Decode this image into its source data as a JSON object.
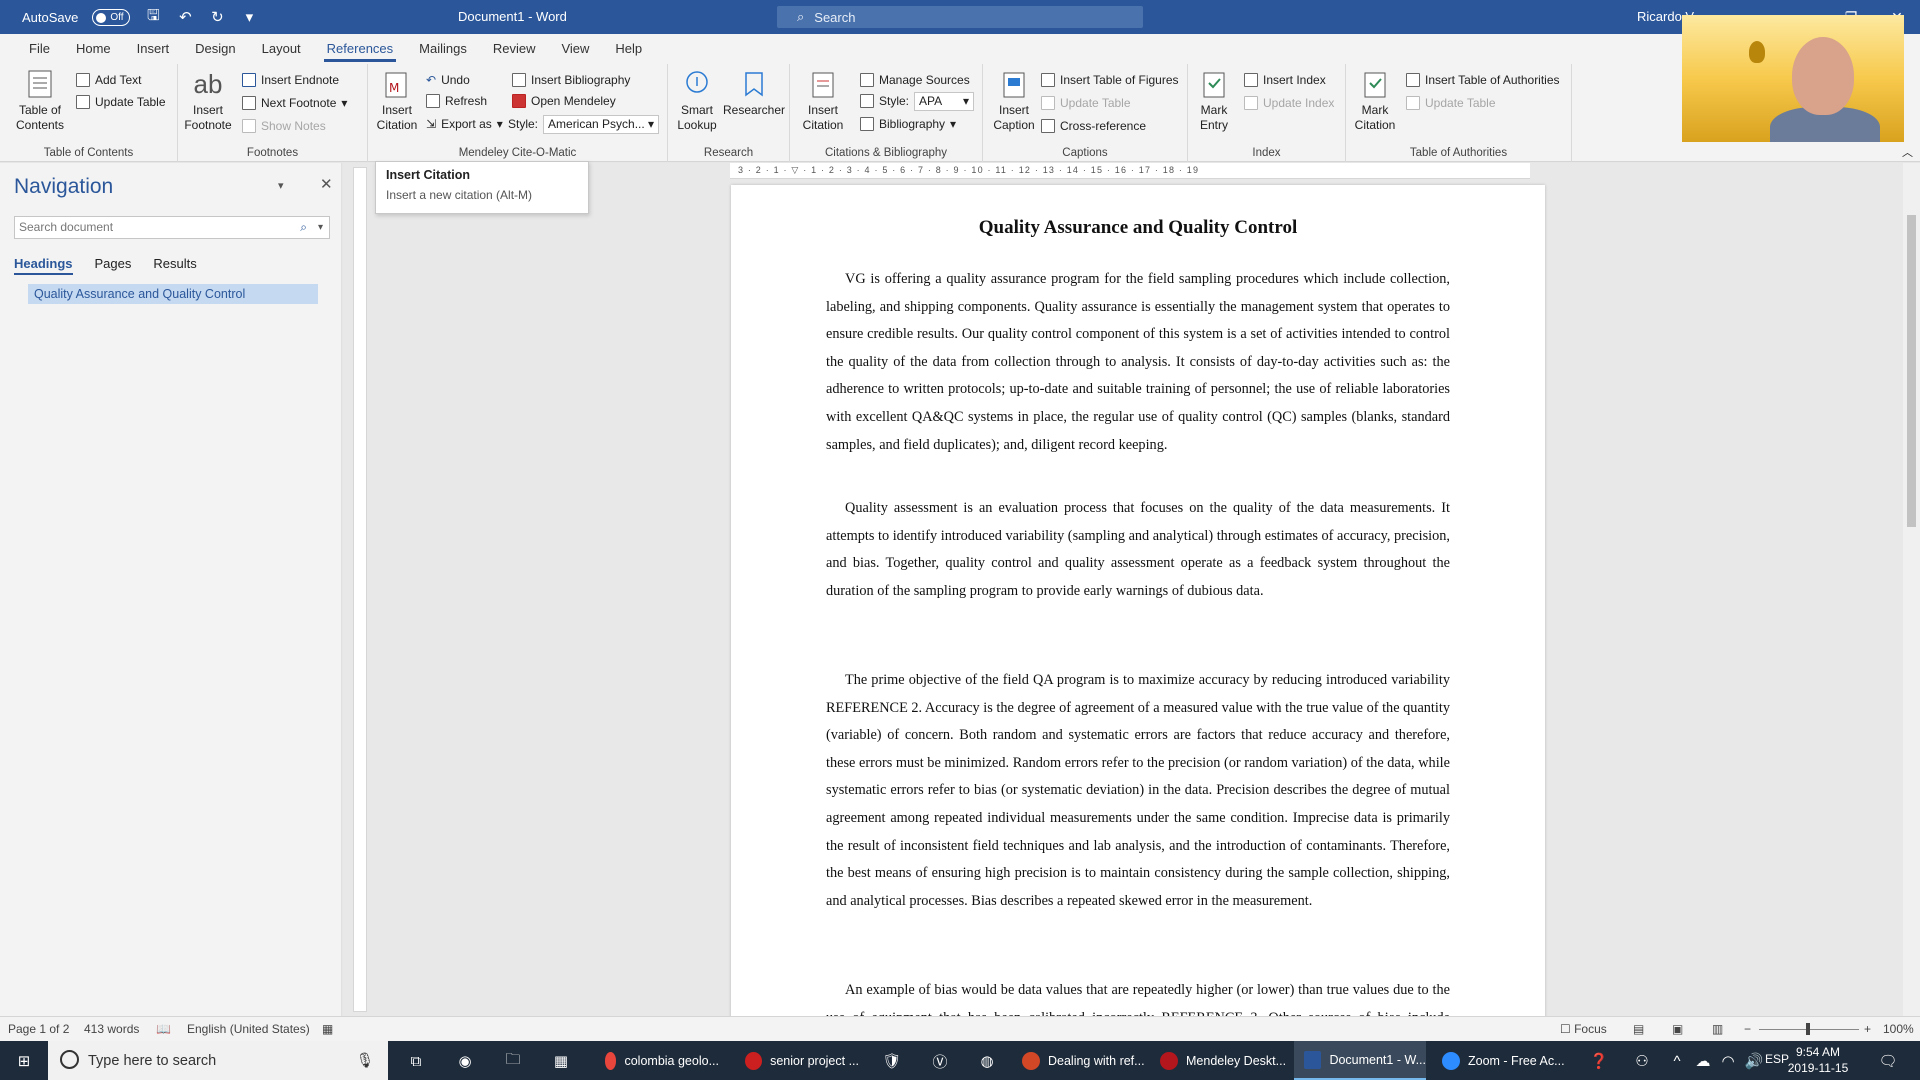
{
  "window": {
    "autosave_label": "AutoSave",
    "autosave_state": "Off",
    "title": "Document1 - Word",
    "search_label": "Search",
    "user_name": "Ricardo V"
  },
  "tabs": [
    "File",
    "Home",
    "Insert",
    "Design",
    "Layout",
    "References",
    "Mailings",
    "Review",
    "View",
    "Help"
  ],
  "active_tab": "References",
  "ribbon": {
    "toc": {
      "big": "Table of Contents",
      "add_text": "Add Text",
      "update_table": "Update Table",
      "label": "Table of Contents"
    },
    "footnotes": {
      "big": "Insert Footnote",
      "insert_endnote": "Insert Endnote",
      "next_footnote": "Next Footnote",
      "show_notes": "Show Notes",
      "label": "Footnotes"
    },
    "mendeley": {
      "big": "Insert Citation",
      "undo": "Undo",
      "refresh": "Refresh",
      "export_as": "Export as",
      "insert_bibliography": "Insert Bibliography",
      "open_mendeley": "Open Mendeley",
      "style_label": "Style:",
      "style_value": "American Psych...",
      "label": "Mendeley Cite-O-Matic"
    },
    "research": {
      "smart_lookup": "Smart Lookup",
      "researcher": "Researcher",
      "label": "Research"
    },
    "citations": {
      "big": "Insert Citation",
      "manage_sources": "Manage Sources",
      "style_label": "Style:",
      "style_value": "APA",
      "bibliography": "Bibliography",
      "label": "Citations & Bibliography"
    },
    "captions": {
      "big": "Insert Caption",
      "insert_tof": "Insert Table of Figures",
      "update_table": "Update Table",
      "cross_reference": "Cross-reference",
      "label": "Captions"
    },
    "index": {
      "big": "Mark Entry",
      "insert_index": "Insert Index",
      "update_index": "Update Index",
      "label": "Index"
    },
    "toa": {
      "big": "Mark Citation",
      "insert_toa": "Insert Table of Authorities",
      "update_table": "Update Table",
      "label": "Table of Authorities"
    }
  },
  "tooltip": {
    "title": "Insert Citation",
    "description": "Insert a new citation (Alt-M)"
  },
  "navigation": {
    "title": "Navigation",
    "search_placeholder": "Search document",
    "tabs": [
      "Headings",
      "Pages",
      "Results"
    ],
    "headings": [
      "Quality Assurance and Quality Control"
    ]
  },
  "ruler_numbers": "3 · 2 · 1 · ▽ · 1 · 2 · 3 · 4 · 5 · 6 · 7 · 8 · 9 · 10 · 11 · 12 · 13 · 14 · 15 · 16 · 17 · 18 · 19",
  "document": {
    "title": "Quality Assurance and Quality Control",
    "paragraphs": [
      "VG is offering a quality assurance program for the field sampling procedures which include collection, labeling, and shipping components. Quality assurance is essentially the management system that operates to ensure credible results. Our quality control component of this system is a set of activities intended to control the quality of the data from collection through to analysis. It consists of day-to-day activities such as: the adherence to written protocols; up-to-date and suitable training of personnel; the use of reliable laboratories with excellent QA&QC systems in place, the regular use of quality control (QC) samples (blanks, standard samples, and field duplicates); and, diligent record keeping.",
      "Quality assessment is an evaluation process that focuses on the quality of the data measurements. It attempts to identify introduced variability (sampling and analytical) through estimates of accuracy, precision, and bias. Together, quality control and quality assessment operate as a feedback system throughout the duration of the sampling program to provide early warnings of dubious data.",
      "The prime objective of the field QA program is to maximize accuracy by reducing introduced variability REFERENCE 2. Accuracy is the degree of agreement of a measured value with the true value of the quantity (variable) of concern. Both random and systematic errors are factors that reduce accuracy and therefore, these errors must be minimized. Random errors refer to the precision (or random variation) of the data, while systematic errors refer to bias (or systematic deviation) in the data. Precision describes the degree of mutual agreement among repeated individual measurements under the same condition. Imprecise data is primarily the result of inconsistent field techniques and lab analysis, and the introduction of contaminants. Therefore, the best means of ensuring high precision is to maintain consistency during the sample collection, shipping, and analytical processes. Bias describes a repeated skewed error in the measurement.",
      "An example of bias would be data values that are repeatedly higher (or lower) than true values due to the use of equipment that has been calibrated incorrectly REFERENCE 3. Other sources of bias include unrepresentative sampling, interference (such as temperature effect), and"
    ]
  },
  "statusbar": {
    "page": "Page 1 of 2",
    "words": "413 words",
    "language": "English (United States)",
    "focus": "Focus",
    "zoom": "100%"
  },
  "taskbar": {
    "search_placeholder": "Type here to search",
    "apps": [
      {
        "label": "colombia geolo...",
        "color": "#e8453c"
      },
      {
        "label": "senior project ...",
        "color": "#cc1f1f"
      },
      {
        "label": "Dealing with ref...",
        "color": "#d24726"
      },
      {
        "label": "Mendeley Deskt...",
        "color": "#b3161d"
      },
      {
        "label": "Document1 - W...",
        "color": "#2b579a"
      },
      {
        "label": "Zoom - Free Ac...",
        "color": "#2d8cff"
      }
    ],
    "language": "ESP",
    "time": "9:54 AM",
    "date": "2019-11-15"
  },
  "colors": {
    "accent": "#2b579a",
    "taskbar": "#1e2b3a",
    "nav_highlight": "#c5d9f1"
  }
}
